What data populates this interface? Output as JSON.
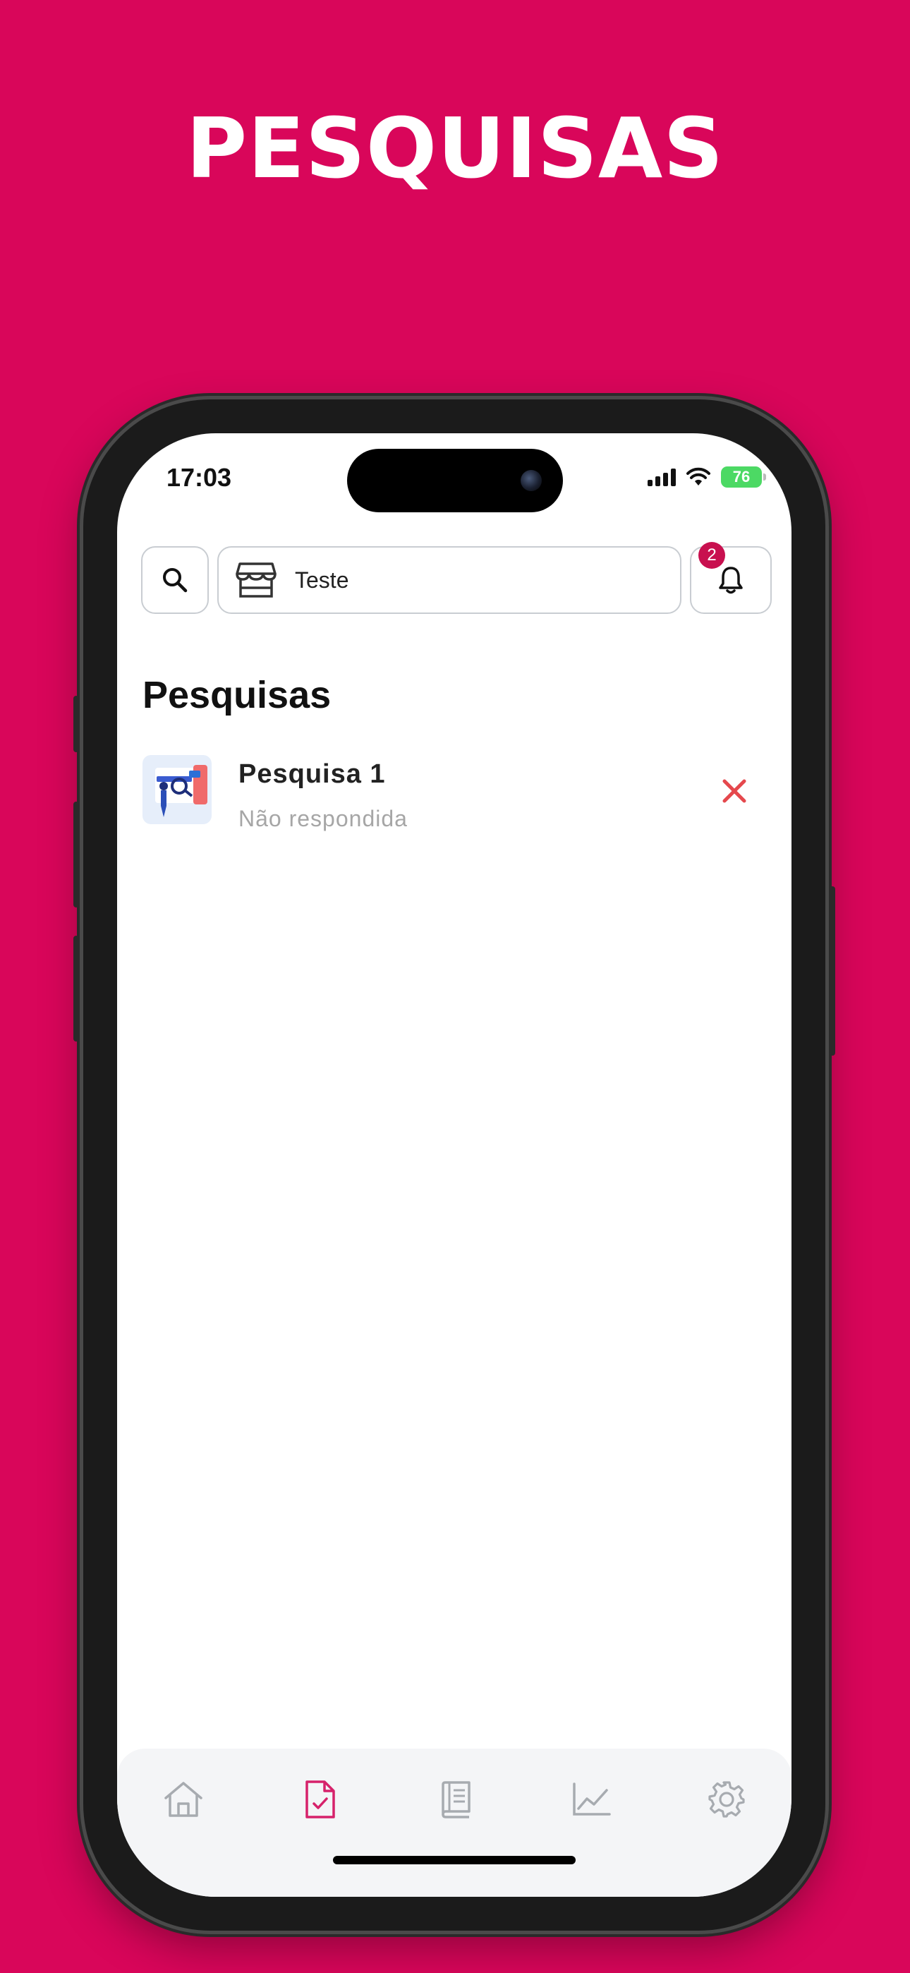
{
  "banner": {
    "title": "PESQUISAS"
  },
  "status_bar": {
    "time": "17:03",
    "battery": "76"
  },
  "header": {
    "store_name": "Teste",
    "notification_count": "2"
  },
  "main": {
    "title": "Pesquisas",
    "surveys": [
      {
        "name": "Pesquisa 1",
        "status": "Não respondida"
      }
    ]
  },
  "colors": {
    "brand": "#d9065a",
    "badge": "#c8104f",
    "remove": "#e5484d",
    "active_tab": "#d6226b",
    "inactive_tab": "#a7abb0"
  },
  "tabbar": {
    "items": [
      {
        "icon": "home-icon",
        "active": false
      },
      {
        "icon": "survey-check-icon",
        "active": true
      },
      {
        "icon": "book-icon",
        "active": false
      },
      {
        "icon": "chart-line-icon",
        "active": false
      },
      {
        "icon": "gear-icon",
        "active": false
      }
    ]
  }
}
